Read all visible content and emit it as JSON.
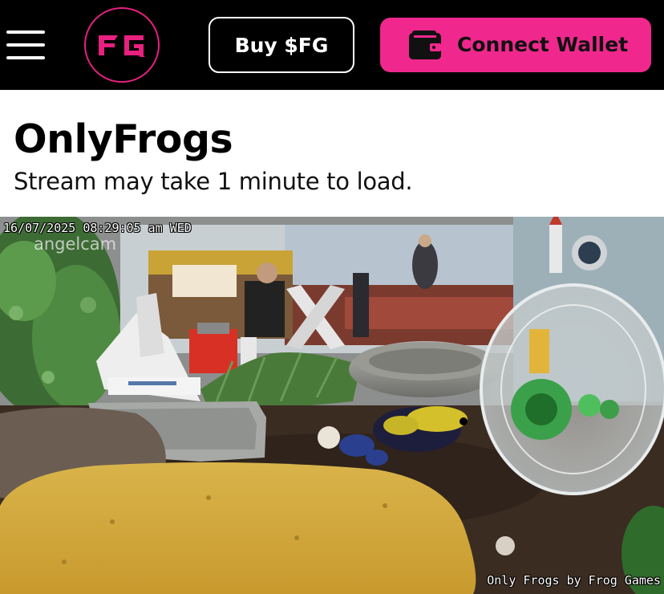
{
  "header": {
    "menu_icon": "hamburger-menu-icon",
    "logo_text": "FG",
    "buy_label": "Buy $FG",
    "wallet_icon": "wallet-icon",
    "wallet_label": "Connect Wallet",
    "colors": {
      "background": "#000000",
      "accent": "#f0288d"
    }
  },
  "main": {
    "title": "OnlyFrogs",
    "subtitle": "Stream may take 1 minute to load."
  },
  "stream": {
    "timestamp": "16/07/2025 08:29:05 am WED",
    "watermark": "angelcam",
    "caption": "Only Frogs by Frog Games"
  }
}
